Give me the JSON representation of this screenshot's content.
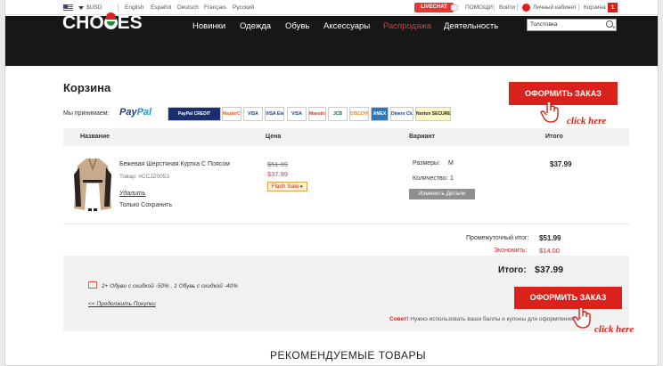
{
  "topbar": {
    "currency": "$USD",
    "languages": [
      "English",
      "Español",
      "Deutsch",
      "Français",
      "Русский"
    ],
    "livechat": "LIVECHAT",
    "help": "ПОМОЩИ",
    "login": "Войти",
    "account": "Личный кабинет",
    "cart": "Корзина",
    "cart_count": "1"
  },
  "header": {
    "logo": "CHO  ES",
    "nav": [
      "Новинки",
      "Одежда",
      "Обувь",
      "Аксессуары",
      "Распродажа",
      "Деятельность"
    ],
    "search_value": "Толстовка"
  },
  "cart": {
    "title": "Корзина",
    "checkout_label": "ОФОРМИТЬ ЗАКАЗ",
    "accept_label": "Мы принимаем:",
    "paypal": [
      "Pay",
      "Pal"
    ],
    "cards": [
      "PayPal CREDIT",
      "MasterCard",
      "VISA",
      "VISA Electron",
      "VISA",
      "Maestro",
      "JCB",
      "DISCOVER",
      "AMEX",
      "Diners Club International",
      "Norton SECURED"
    ],
    "columns": [
      "Название",
      "Цена",
      "Вариант",
      "Итого"
    ],
    "item": {
      "name": "Бежевая Шерстяная Куртка С Поясом",
      "sku": "Товар: #CCJZ0053",
      "remove": "Удалить",
      "save_only": "Только Сохранить",
      "old_price": "$51.99",
      "new_price": "$37.99",
      "flash_sale": "Flash Sale ▸",
      "size_label": "Размеры:",
      "size_value": "M",
      "qty_label": "Количество:",
      "qty_value": "1",
      "edit_label": "Изменить Детали",
      "total": "$37.99"
    },
    "subtotal_label": "Промежуточный итог:",
    "subtotal_value": "$51.99",
    "savings_label": "Экономить:",
    "savings_value": "$14.00",
    "grand_total_label": "Итого:",
    "grand_total_value": "$37.99",
    "promo": "2+ Обуви с скидкой -50% , 1 Обувь с скидкой -40%",
    "continue": "<< Продолжить Покупки",
    "tip_prefix": "Совет!",
    "tip_text": "Нужно использовать ваши баллы и купоны для оформления заказ.",
    "click_here": "click here",
    "recommended": "РЕКОМЕНДУЕМЫЕ ТОВАРЫ"
  },
  "colors": {
    "accent": "#d9221c",
    "header_bg": "#171717",
    "panel_bg": "#f1f1f1"
  }
}
